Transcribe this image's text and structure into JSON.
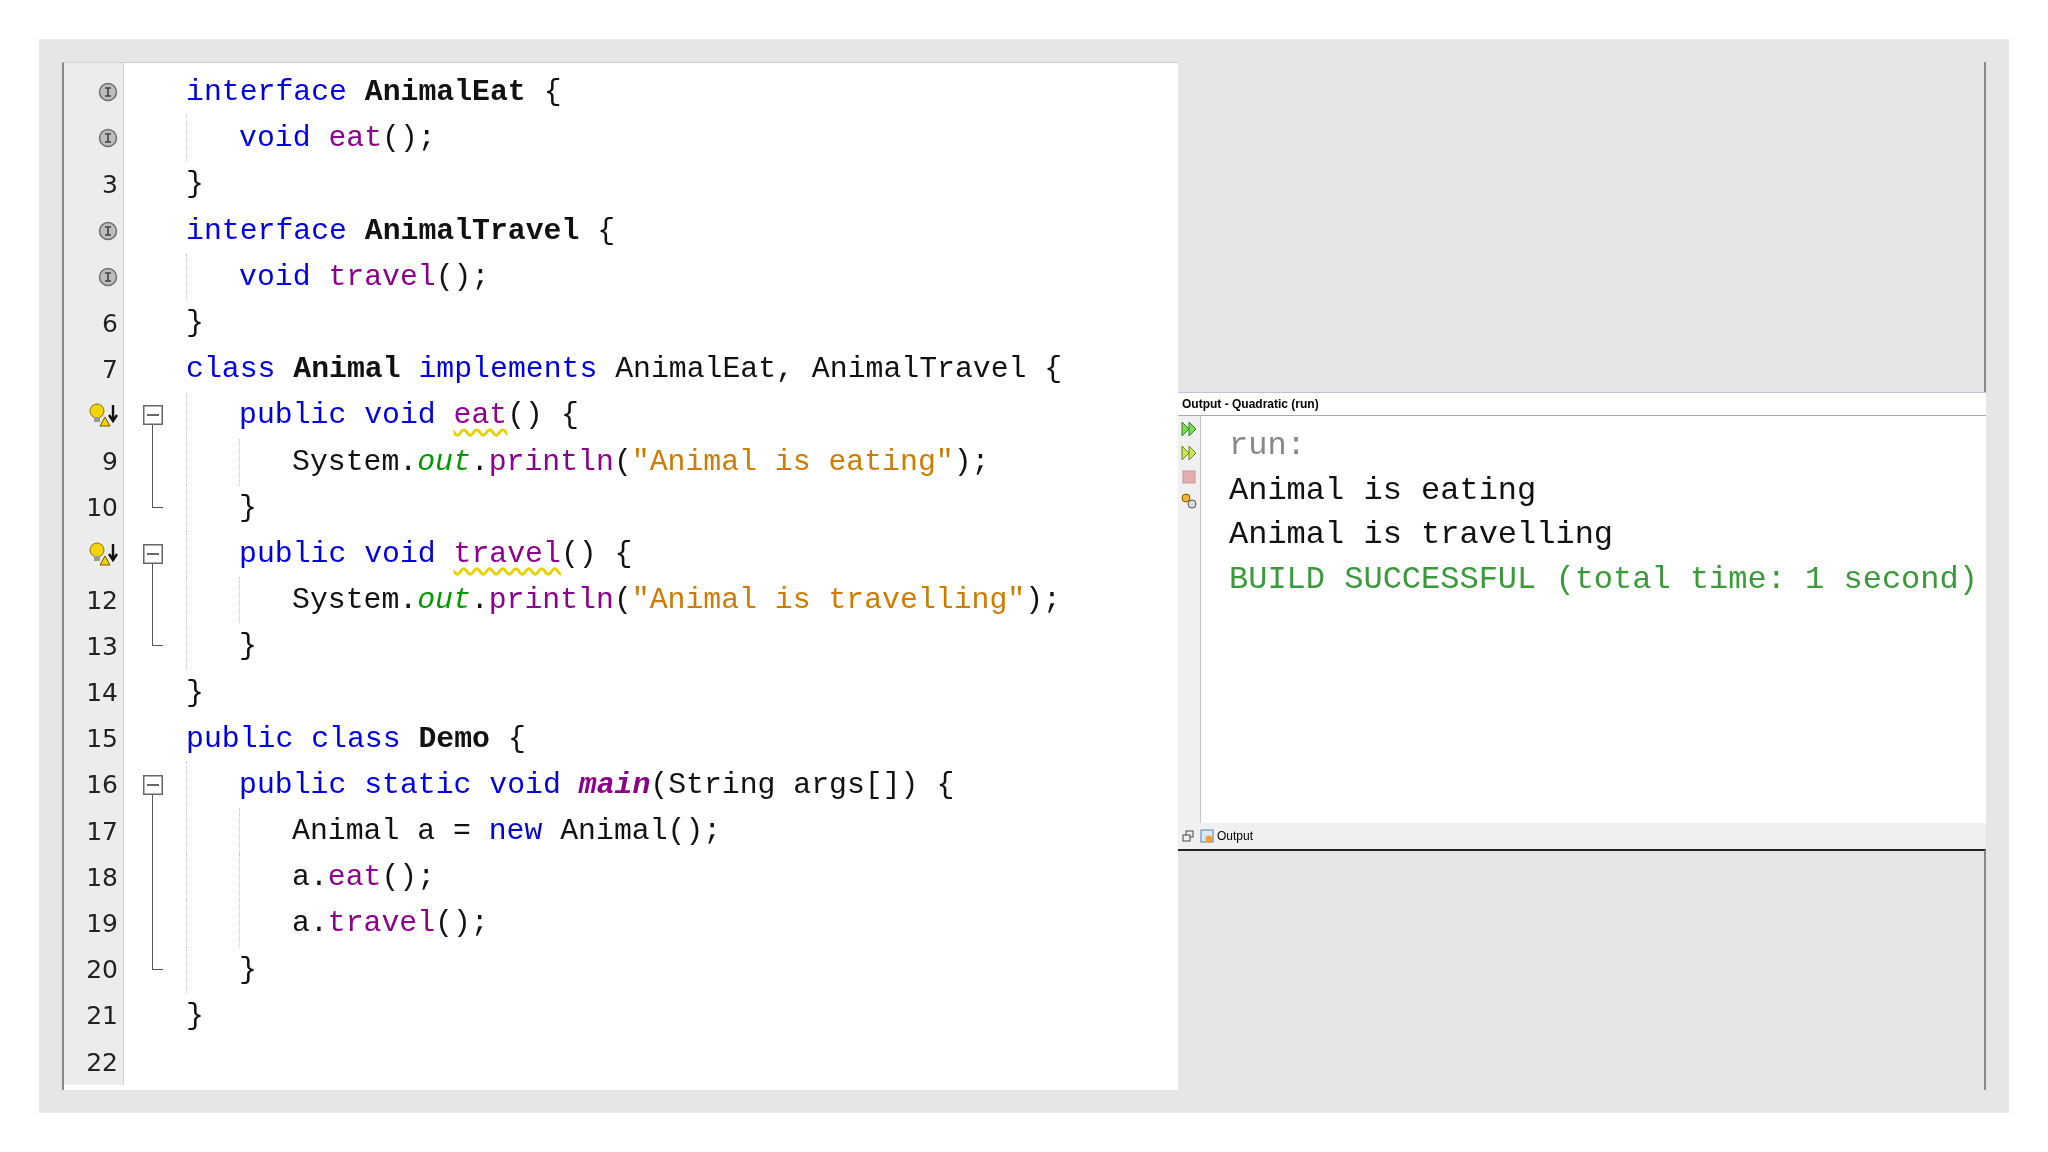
{
  "editor": {
    "lines": [
      {
        "kind": "implemented",
        "tokens": [
          {
            "t": "interface ",
            "kind": "keyword"
          },
          {
            "t": "AnimalEat",
            "kind": "type-name"
          },
          {
            "t": " {",
            "kind": "plain"
          }
        ],
        "children": [
          {
            "kind": "implemented",
            "tokens": [
              {
                "t": "void ",
                "kind": "keyword"
              },
              {
                "t": "eat",
                "kind": "method"
              },
              {
                "t": "();",
                "kind": "plain"
              }
            ]
          }
        ],
        "close": {
          "number": "3",
          "tokens": [
            {
              "t": "}",
              "kind": "plain"
            }
          ]
        }
      },
      {
        "kind": "implemented",
        "tokens": [
          {
            "t": "interface ",
            "kind": "keyword"
          },
          {
            "t": "AnimalTravel",
            "kind": "type-name"
          },
          {
            "t": " {",
            "kind": "plain"
          }
        ],
        "children": [
          {
            "kind": "implemented",
            "tokens": [
              {
                "t": "void ",
                "kind": "keyword"
              },
              {
                "t": "travel",
                "kind": "method"
              },
              {
                "t": "();",
                "kind": "plain"
              }
            ]
          }
        ],
        "close": {
          "number": "6",
          "tokens": [
            {
              "t": "}",
              "kind": "plain"
            }
          ]
        }
      },
      {
        "number": "7",
        "tokens": [
          {
            "t": "class ",
            "kind": "keyword"
          },
          {
            "t": "Animal",
            "kind": "type-name"
          },
          {
            "t": " implements ",
            "kind": "keyword"
          },
          {
            "t": "AnimalEat, AnimalTravel {",
            "kind": "plain"
          }
        ],
        "children": [
          {
            "kind": "override-warning",
            "foldable": true,
            "tokens": [
              {
                "t": "public void ",
                "kind": "keyword"
              },
              {
                "t": "eat",
                "kind": "method-flagged"
              },
              {
                "t": "() {",
                "kind": "plain"
              }
            ],
            "children": [
              {
                "number": "9",
                "tokens": [
                  {
                    "t": "System.",
                    "kind": "plain"
                  },
                  {
                    "t": "out",
                    "kind": "field"
                  },
                  {
                    "t": ".",
                    "kind": "plain"
                  },
                  {
                    "t": "println",
                    "kind": "method"
                  },
                  {
                    "t": "(",
                    "kind": "plain"
                  },
                  {
                    "t": "\"Animal is eating\"",
                    "kind": "string"
                  },
                  {
                    "t": ");",
                    "kind": "plain"
                  }
                ]
              }
            ],
            "close": {
              "number": "10",
              "tokens": [
                {
                  "t": "}",
                  "kind": "plain"
                }
              ]
            }
          },
          {
            "kind": "override-warning",
            "foldable": true,
            "tokens": [
              {
                "t": "public void ",
                "kind": "keyword"
              },
              {
                "t": "travel",
                "kind": "method-flagged"
              },
              {
                "t": "() {",
                "kind": "plain"
              }
            ],
            "children": [
              {
                "number": "12",
                "tokens": [
                  {
                    "t": "System.",
                    "kind": "plain"
                  },
                  {
                    "t": "out",
                    "kind": "field"
                  },
                  {
                    "t": ".",
                    "kind": "plain"
                  },
                  {
                    "t": "println",
                    "kind": "method"
                  },
                  {
                    "t": "(",
                    "kind": "plain"
                  },
                  {
                    "t": "\"Animal is travelling\"",
                    "kind": "string"
                  },
                  {
                    "t": ");",
                    "kind": "plain"
                  }
                ]
              }
            ],
            "close": {
              "number": "13",
              "tokens": [
                {
                  "t": "}",
                  "kind": "plain"
                }
              ]
            }
          }
        ],
        "close": {
          "number": "14",
          "tokens": [
            {
              "t": "}",
              "kind": "plain"
            }
          ]
        }
      },
      {
        "number": "15",
        "tokens": [
          {
            "t": "public class ",
            "kind": "keyword"
          },
          {
            "t": "Demo",
            "kind": "type-name"
          },
          {
            "t": " {",
            "kind": "plain"
          }
        ],
        "children": [
          {
            "number": "16",
            "foldable": true,
            "tokens": [
              {
                "t": "public static void ",
                "kind": "keyword"
              },
              {
                "t": "main",
                "kind": "main-method"
              },
              {
                "t": "(String args[]) {",
                "kind": "plain"
              }
            ],
            "children": [
              {
                "number": "17",
                "tokens": [
                  {
                    "t": "Animal a = ",
                    "kind": "plain"
                  },
                  {
                    "t": "new ",
                    "kind": "keyword"
                  },
                  {
                    "t": "Animal();",
                    "kind": "plain"
                  }
                ]
              },
              {
                "number": "18",
                "tokens": [
                  {
                    "t": "a.",
                    "kind": "plain"
                  },
                  {
                    "t": "eat",
                    "kind": "method"
                  },
                  {
                    "t": "();",
                    "kind": "plain"
                  }
                ]
              },
              {
                "number": "19",
                "tokens": [
                  {
                    "t": "a.",
                    "kind": "plain"
                  },
                  {
                    "t": "travel",
                    "kind": "method"
                  },
                  {
                    "t": "();",
                    "kind": "plain"
                  }
                ]
              }
            ],
            "close": {
              "number": "20",
              "tokens": [
                {
                  "t": "}",
                  "kind": "plain"
                }
              ]
            }
          }
        ],
        "close": {
          "number": "21",
          "tokens": [
            {
              "t": "}",
              "kind": "plain"
            }
          ]
        }
      },
      {
        "number": "22"
      }
    ]
  },
  "output": {
    "title": "Output - Quadratic (run)",
    "toolbar": [
      {
        "kind": "rerun",
        "disabled": false
      },
      {
        "kind": "rerun-options",
        "disabled": false
      },
      {
        "kind": "stop",
        "disabled": true
      },
      {
        "kind": "settings",
        "disabled": false
      }
    ],
    "lines": [
      {
        "text": "run:",
        "kind": "info"
      },
      {
        "text": "Animal is eating",
        "kind": "stdout"
      },
      {
        "text": "Animal is travelling",
        "kind": "stdout"
      },
      {
        "text": "BUILD SUCCESSFUL (total time: 1 second)",
        "kind": "success"
      }
    ],
    "tab": {
      "label": "Output"
    }
  }
}
